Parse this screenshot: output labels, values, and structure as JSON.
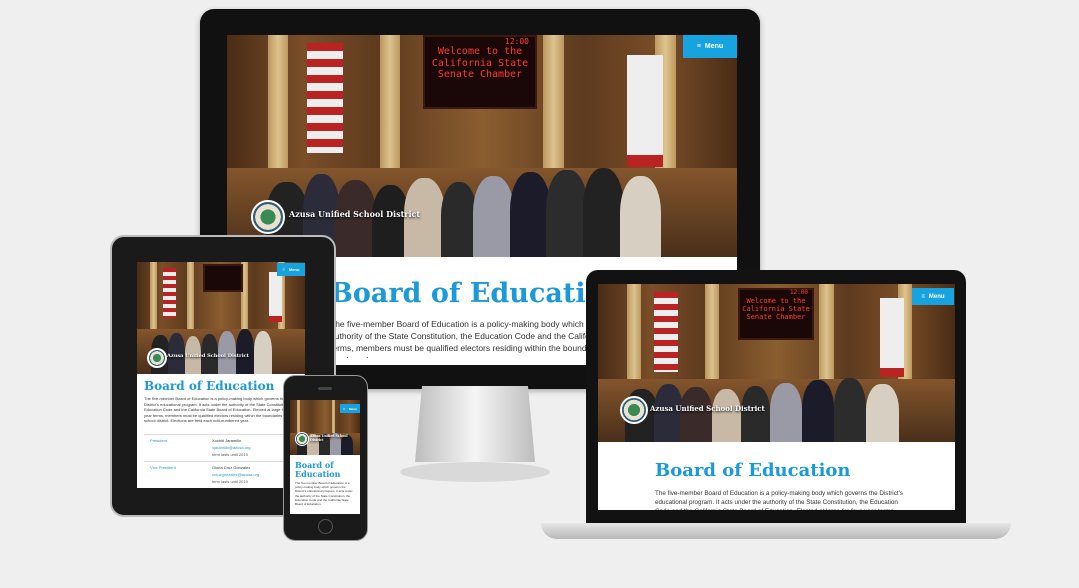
{
  "sign": {
    "line1": "12:00",
    "line2": "Welcome to the",
    "line3": "California State",
    "line4": "Senate Chamber"
  },
  "brand": {
    "name": "Azusa Unified School District"
  },
  "menu": {
    "label": "Menu",
    "icon": "hamburger-icon"
  },
  "page": {
    "title": "Board of Education",
    "intro_desktop": "The five-member Board of Education is a policy-making body which governs the District's educational program. It acts under the authority of the State Constitution, the Education Code and the California State Board of Education. Elected at large for four-year terms, members must be qualified electors residing within the boundaries of the school district. Elections are held each odd-numbered year.",
    "intro_laptop": "The five-member Board of Education is a policy-making body which governs the District's educational program. It acts under the authority of the State Constitution, the Education Code and the California State Board of Education. Elected at large for four-year terms, members must be qualified electors residing within the boundaries of the school district.",
    "intro_tablet": "The five-member Board of Education is a policy-making body which governs the District's educational program. It acts under the authority of the State Constitution, the Education Code and the California State Board of Education. Elected at large for four-year terms, members must be qualified electors residing within the boundaries of the school district. Elections are held each odd-numbered year.",
    "intro_phone": "The five-member Board of Education is a policy-making body which governs the District's educational program. It acts under the authority of the State Constitution, the Education Code and the California State Board of Education."
  },
  "members": [
    {
      "role": "President",
      "name": "Xochitl Jaramillo",
      "email": "xjaramillo@azusa.org",
      "term": "term lasts until 2019"
    },
    {
      "role": "Vice President",
      "name": "Gloria Cruz Gonzalez",
      "email": "ccruzgonzalez@azusa.org",
      "term": "term lasts until 2019"
    }
  ],
  "colors": {
    "accent": "#16a3e0",
    "title": "#1a9ad8",
    "page_bg": "#efefef"
  }
}
